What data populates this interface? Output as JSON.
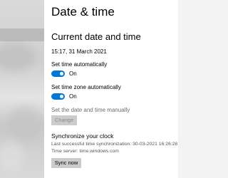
{
  "page": {
    "title": "Date & time",
    "section_title": "Current date and time",
    "current_datetime": "15:17, 31 March 2021"
  },
  "settings": {
    "set_time_auto": {
      "label": "Set time automatically",
      "state": "On",
      "enabled": true
    },
    "set_timezone_auto": {
      "label": "Set time zone automatically",
      "state": "On",
      "enabled": true
    },
    "manual": {
      "label": "Set the date and time manually",
      "button_label": "Change"
    }
  },
  "sync": {
    "heading": "Synchronize your clock",
    "last_sync": "Last successful time synchronization: 30-03-2021 16:26:28",
    "server": "Time server: time.windows.com",
    "button_label": "Sync now"
  },
  "colors": {
    "accent": "#0078d7",
    "background": "#ffffff",
    "nav_background": "#d6d6d6"
  }
}
